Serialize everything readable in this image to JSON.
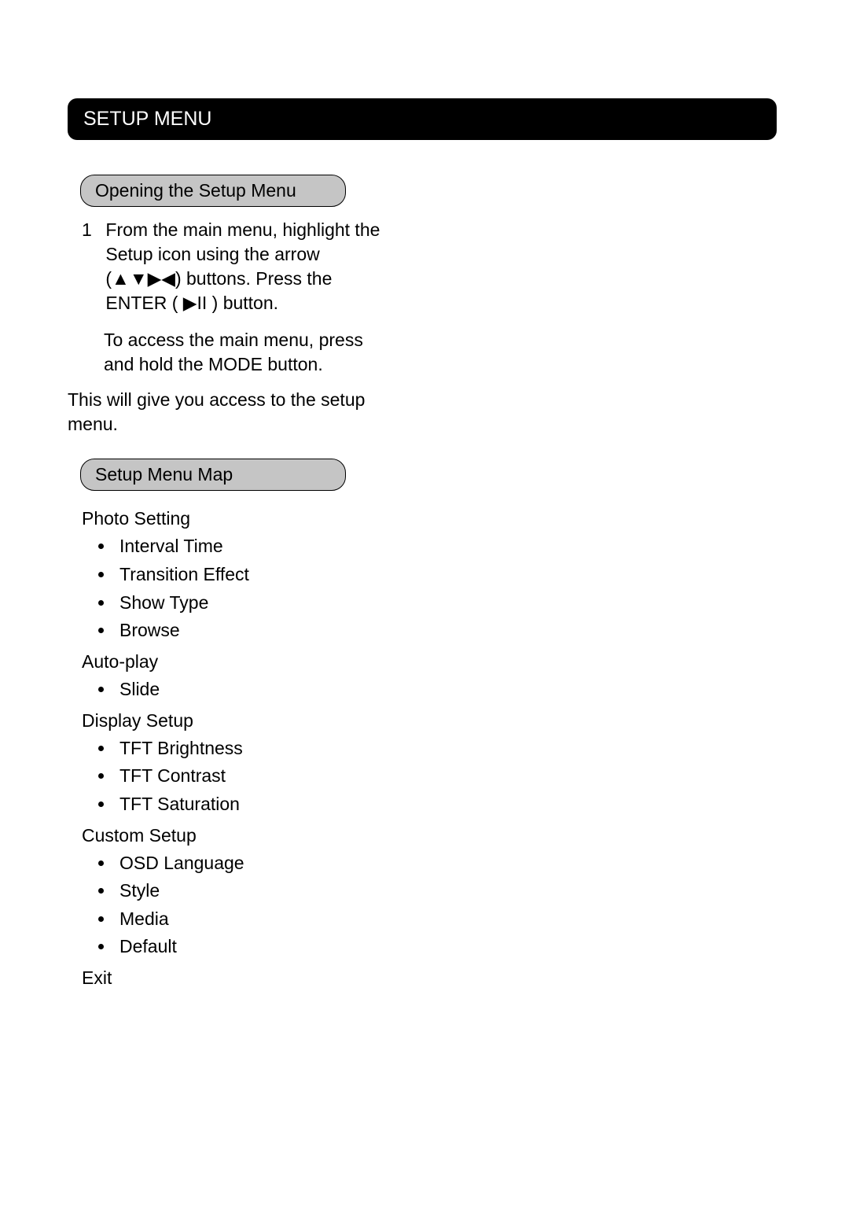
{
  "section_header": "SETUP MENU",
  "subsection1": "Opening the Setup Menu",
  "step1_num": "1",
  "step1_text": "From the main menu, highlight the Setup icon using the arrow (▲▼▶◀) buttons. Press the ENTER ( ▶II ) button.",
  "step1_sub": "To access the main menu, press and hold the MODE button.",
  "paragraph": "This will give you access to the setup menu.",
  "subsection2": "Setup Menu Map",
  "map": {
    "photo_setting": "Photo Setting",
    "photo_items": [
      "Interval Time",
      "Transition Effect",
      "Show Type",
      "Browse"
    ],
    "auto_play": "Auto-play",
    "auto_items": [
      "Slide"
    ],
    "display_setup": "Display Setup",
    "display_items": [
      "TFT Brightness",
      "TFT Contrast",
      "TFT Saturation"
    ],
    "custom_setup": "Custom Setup",
    "custom_items": [
      "OSD Language",
      "Style",
      "Media",
      "Default"
    ],
    "exit": "Exit"
  },
  "footer_left": "",
  "footer_page": ""
}
